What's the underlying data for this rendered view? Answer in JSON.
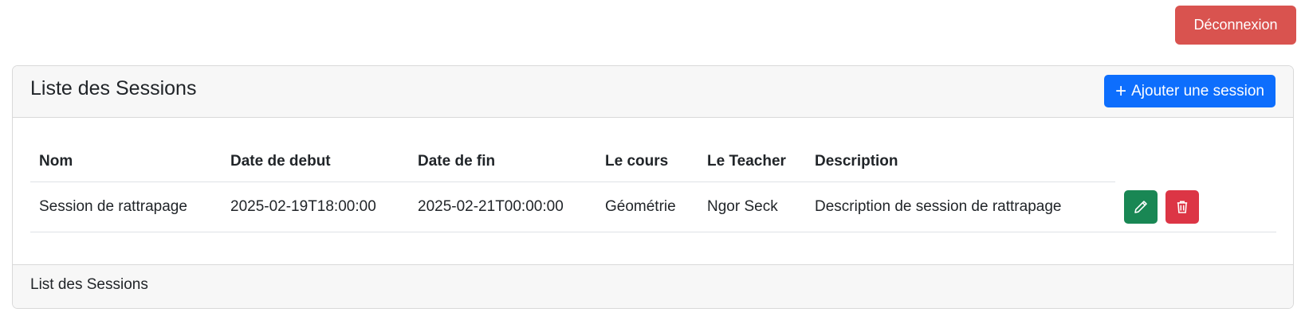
{
  "header": {
    "logout_label": "Déconnexion"
  },
  "card": {
    "title": "Liste des Sessions",
    "add_button_label": "Ajouter une session",
    "footer_text": "List des Sessions"
  },
  "table": {
    "columns": [
      "Nom",
      "Date de debut",
      "Date de fin",
      "Le cours",
      "Le Teacher",
      "Description"
    ],
    "rows": [
      {
        "nom": "Session de rattrapage",
        "date_debut": "2025-02-19T18:00:00",
        "date_fin": "2025-02-21T00:00:00",
        "cours": "Géométrie",
        "teacher": "Ngor Seck",
        "description": "Description de session de rattrapage"
      }
    ]
  },
  "icons": {
    "add": "plus-icon",
    "edit": "pencil-icon",
    "delete": "trash-icon"
  },
  "colors": {
    "logout": "#d9534f",
    "primary": "#0d6efd",
    "edit": "#198754",
    "delete": "#dc3545",
    "header_bg": "#f7f7f7"
  }
}
